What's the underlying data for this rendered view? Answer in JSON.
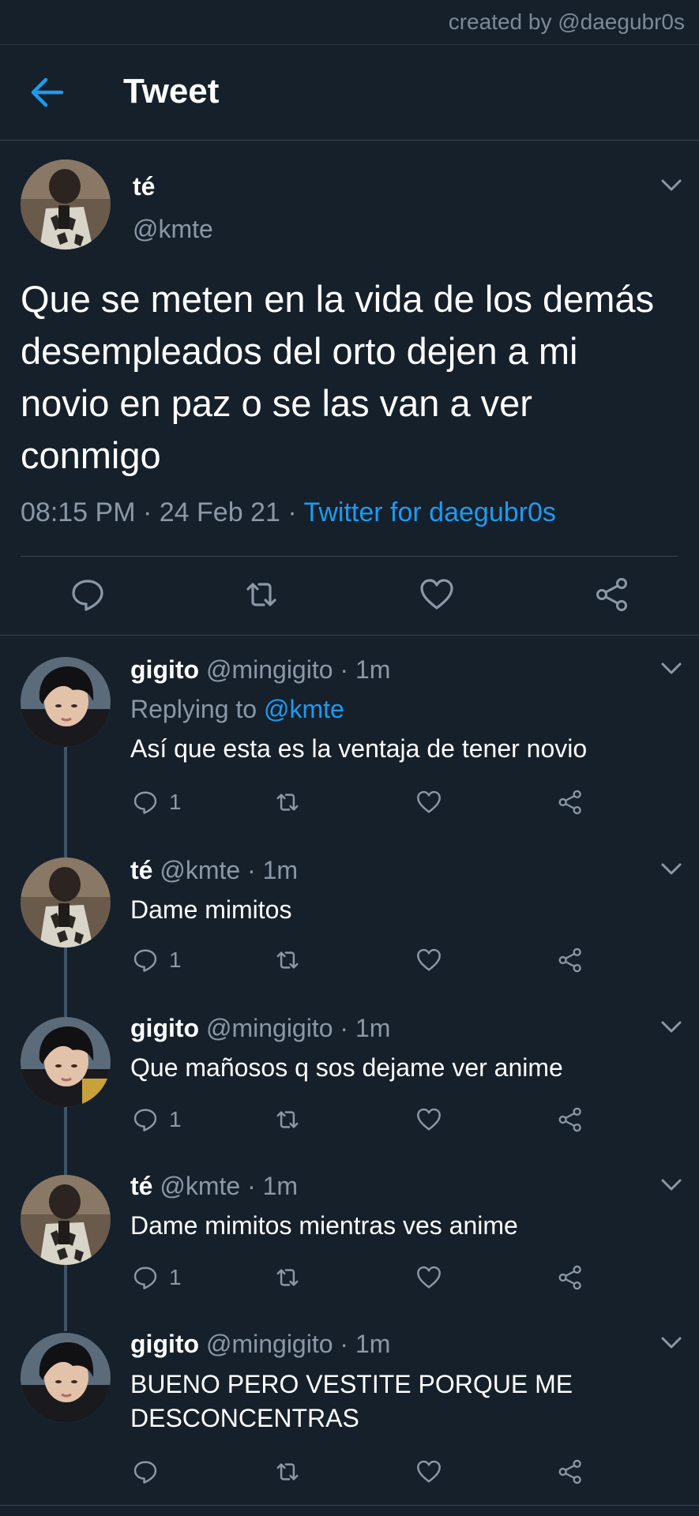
{
  "credit": "created by @daegubr0s",
  "header": {
    "title": "Tweet"
  },
  "main_tweet": {
    "name": "té",
    "handle": "@kmte",
    "text": "Que se meten en la vida de los demás desempleados del orto dejen a mi novio en paz o se las van a ver conmigo",
    "time": "08:15 PM",
    "date": "24 Feb 21",
    "source": "Twitter for daegubr0s"
  },
  "icons": {
    "back": "arrow-left-icon",
    "reply": "reply-icon",
    "retweet": "retweet-icon",
    "like": "heart-icon",
    "share": "share-icon",
    "more": "chevron-down-icon"
  },
  "colors": {
    "background": "#15202b",
    "accent": "#1d9bf0",
    "secondary_text": "#8b98a5"
  },
  "replies": [
    {
      "name": "gigito",
      "handle": "@mingigito",
      "time": "1m",
      "replying_label": "Replying to",
      "replying_to": "@kmte",
      "text": "Así que esta es la ventaja de tener novio",
      "reply_count": "1"
    },
    {
      "name": "té",
      "handle": "@kmte",
      "time": "1m",
      "text": "Dame mimitos",
      "reply_count": "1"
    },
    {
      "name": "gigito",
      "handle": "@mingigito",
      "time": "1m",
      "text": "Que mañosos q sos dejame ver anime",
      "reply_count": "1"
    },
    {
      "name": "té",
      "handle": "@kmte",
      "time": "1m",
      "text": "Dame mimitos mientras ves anime",
      "reply_count": "1"
    },
    {
      "name": "gigito",
      "handle": "@mingigito",
      "time": "1m",
      "text": "BUENO PERO VESTITE PORQUE ME DESCONCENTRAS"
    }
  ]
}
